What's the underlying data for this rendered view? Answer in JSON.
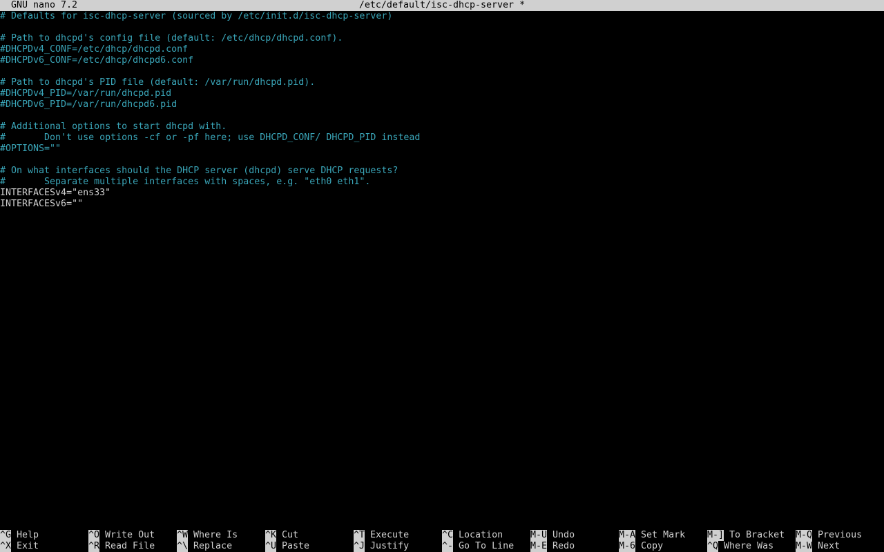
{
  "titlebar": {
    "app": "GNU nano 7.2",
    "file": "/etc/default/isc-dhcp-server *"
  },
  "editor": {
    "lines": [
      "# Defaults for isc-dhcp-server (sourced by /etc/init.d/isc-dhcp-server)",
      "",
      "# Path to dhcpd's config file (default: /etc/dhcp/dhcpd.conf).",
      "#DHCPDv4_CONF=/etc/dhcp/dhcpd.conf",
      "#DHCPDv6_CONF=/etc/dhcp/dhcpd6.conf",
      "",
      "# Path to dhcpd's PID file (default: /var/run/dhcpd.pid).",
      "#DHCPDv4_PID=/var/run/dhcpd.pid",
      "#DHCPDv6_PID=/var/run/dhcpd6.pid",
      "",
      "# Additional options to start dhcpd with.",
      "#       Don't use options -cf or -pf here; use DHCPD_CONF/ DHCPD_PID instead",
      "#OPTIONS=\"\"",
      "",
      "# On what interfaces should the DHCP server (dhcpd) serve DHCP requests?",
      "#       Separate multiple interfaces with spaces, e.g. \"eth0 eth1\".",
      "INTERFACESv4=\"ens33\"",
      "INTERFACESv6=\"\""
    ]
  },
  "shortcuts": {
    "row1": [
      {
        "key": "^G",
        "label": "Help"
      },
      {
        "key": "^O",
        "label": "Write Out"
      },
      {
        "key": "^W",
        "label": "Where Is"
      },
      {
        "key": "^K",
        "label": "Cut"
      },
      {
        "key": "^T",
        "label": "Execute"
      },
      {
        "key": "^C",
        "label": "Location"
      },
      {
        "key": "M-U",
        "label": "Undo"
      },
      {
        "key": "M-A",
        "label": "Set Mark"
      },
      {
        "key": "M-]",
        "label": "To Bracket"
      },
      {
        "key": "M-Q",
        "label": "Previous"
      }
    ],
    "row2": [
      {
        "key": "^X",
        "label": "Exit"
      },
      {
        "key": "^R",
        "label": "Read File"
      },
      {
        "key": "^\\",
        "label": "Replace"
      },
      {
        "key": "^U",
        "label": "Paste"
      },
      {
        "key": "^J",
        "label": "Justify"
      },
      {
        "key": "^-",
        "label": "Go To Line"
      },
      {
        "key": "M-E",
        "label": "Redo"
      },
      {
        "key": "M-6",
        "label": "Copy"
      },
      {
        "key": "^Q",
        "label": "Where Was"
      },
      {
        "key": "M-W",
        "label": "Next"
      }
    ]
  },
  "colors": {
    "background": "#000000",
    "comment": "#3aa6b9",
    "text": "#d0d0d0",
    "titlebar_bg": "#d0d0d0"
  }
}
